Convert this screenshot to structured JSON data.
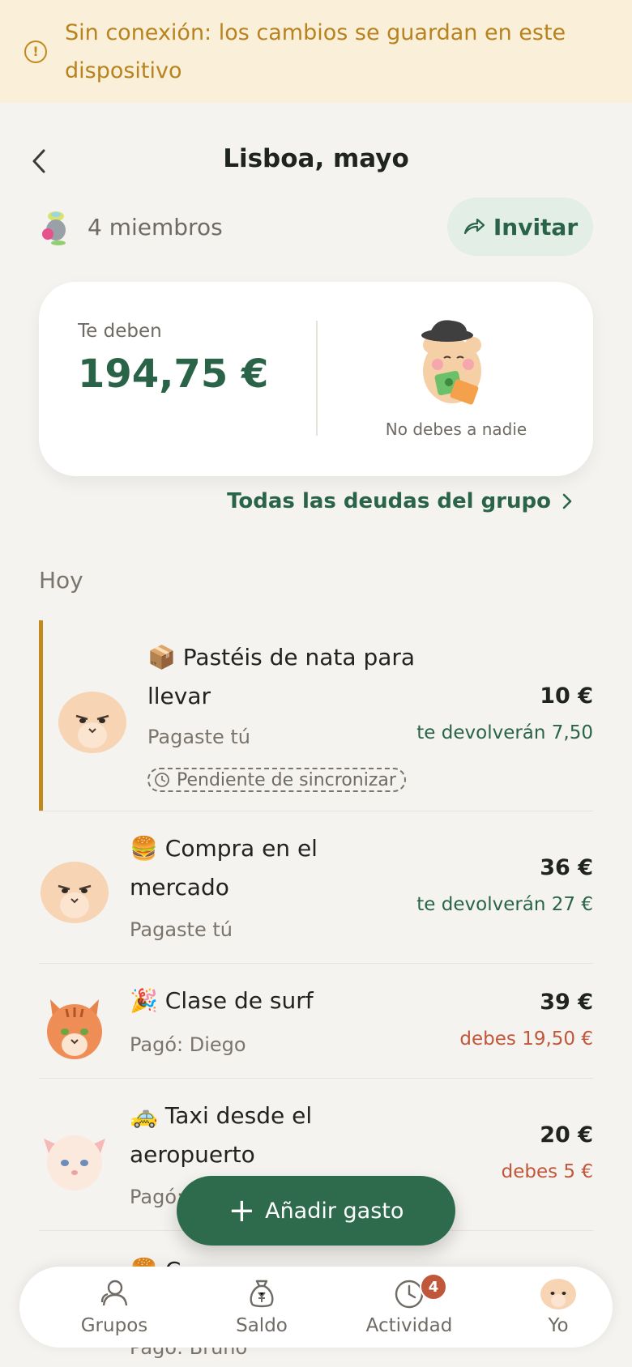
{
  "banner": {
    "text": "Sin conexión: los cambios se guardan en este dispositivo",
    "icon": "warning-circle-icon"
  },
  "header": {
    "title": "Lisboa, mayo"
  },
  "group": {
    "members": "4 miembros",
    "invite_label": "Invitar"
  },
  "balance": {
    "label": "Te deben",
    "amount": "194,75 €",
    "status": "No debes a nadie"
  },
  "all_debts_label": "Todas las deudas del grupo",
  "section": "Hoy",
  "expenses": [
    {
      "emoji": "📦",
      "name": "Pastéis de nata para llevar",
      "payer": "Pagaste tú",
      "amount": "10 €",
      "share": "te devolverán 7,50 €",
      "pending": "Pendiente de sincronizar"
    },
    {
      "emoji": "🍔",
      "name": "Compra en el mercado",
      "payer": "Pagaste tú",
      "amount": "36 €",
      "share": "te devolverán 27 €"
    },
    {
      "emoji": "🎉",
      "name": "Clase de surf",
      "payer": "Pagó: Diego",
      "amount": "39 €",
      "share": "debes 19,50 €"
    },
    {
      "emoji": "🚕",
      "name": "Taxi desde el aeropuerto",
      "payer": "Pagó:",
      "amount": "20 €",
      "share": "debes 5 €"
    },
    {
      "emoji": "🍔",
      "name": "C",
      "payer": "Pagó: Bruno"
    }
  ],
  "fab_label": "Añadir gasto",
  "tabs": [
    {
      "label": "Grupos",
      "icon": "people-icon"
    },
    {
      "label": "Saldo",
      "icon": "money-bag-icon"
    },
    {
      "label": "Actividad",
      "icon": "clock-icon",
      "badge": "4"
    },
    {
      "label": "Yo",
      "icon": "avatar-icon"
    }
  ],
  "colors": {
    "primary": "#2a6448",
    "danger": "#c1573a",
    "warning": "#b8831f",
    "background": "#f5f3ef"
  }
}
